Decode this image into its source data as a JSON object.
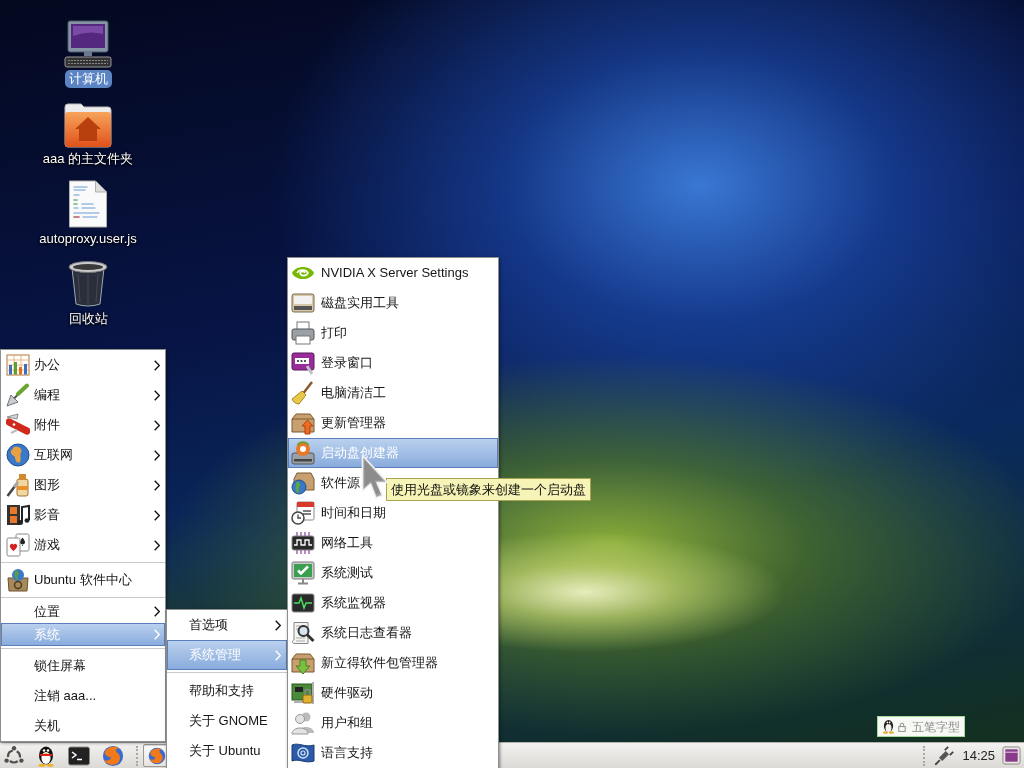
{
  "desktop_icons": [
    {
      "label": "计算机",
      "selected": true
    },
    {
      "label": "aaa 的主文件夹",
      "selected": false
    },
    {
      "label": "autoproxy.user.js",
      "selected": false
    },
    {
      "label": "回收站",
      "selected": false
    }
  ],
  "main_menu": {
    "sections": [
      [
        {
          "label": "办公",
          "submenu": true,
          "selected": false
        },
        {
          "label": "编程",
          "submenu": true,
          "selected": false
        },
        {
          "label": "附件",
          "submenu": true,
          "selected": false
        },
        {
          "label": "互联网",
          "submenu": true,
          "selected": false
        },
        {
          "label": "图形",
          "submenu": true,
          "selected": false
        },
        {
          "label": "影音",
          "submenu": true,
          "selected": false
        },
        {
          "label": "游戏",
          "submenu": true,
          "selected": false
        }
      ],
      [
        {
          "label": "Ubuntu 软件中心",
          "submenu": false,
          "selected": false
        }
      ],
      [
        {
          "label": "位置",
          "submenu": true,
          "selected": false
        },
        {
          "label": "系统",
          "submenu": true,
          "selected": true
        }
      ],
      [
        {
          "label": "锁住屏幕",
          "submenu": false,
          "selected": false
        },
        {
          "label": "注销 aaa...",
          "submenu": false,
          "selected": false
        },
        {
          "label": "关机",
          "submenu": false,
          "selected": false
        }
      ]
    ]
  },
  "system_submenu": {
    "sections": [
      [
        {
          "label": "首选项",
          "submenu": true,
          "selected": false
        },
        {
          "label": "系统管理",
          "submenu": true,
          "selected": true
        }
      ],
      [
        {
          "label": "帮助和支持",
          "submenu": false,
          "selected": false
        },
        {
          "label": "关于 GNOME",
          "submenu": false,
          "selected": false
        },
        {
          "label": "关于 Ubuntu",
          "submenu": false,
          "selected": false
        }
      ]
    ]
  },
  "administration_submenu": {
    "items": [
      {
        "label": "NVIDIA X Server Settings",
        "selected": false
      },
      {
        "label": "磁盘实用工具",
        "selected": false
      },
      {
        "label": "打印",
        "selected": false
      },
      {
        "label": "登录窗口",
        "selected": false
      },
      {
        "label": "电脑清洁工",
        "selected": false
      },
      {
        "label": "更新管理器",
        "selected": false
      },
      {
        "label": "启动盘创建器",
        "selected": true
      },
      {
        "label": "软件源",
        "selected": false
      },
      {
        "label": "时间和日期",
        "selected": false
      },
      {
        "label": "网络工具",
        "selected": false
      },
      {
        "label": "系统测试",
        "selected": false
      },
      {
        "label": "系统监视器",
        "selected": false
      },
      {
        "label": "系统日志查看器",
        "selected": false
      },
      {
        "label": "新立得软件包管理器",
        "selected": false
      },
      {
        "label": "硬件驱动",
        "selected": false
      },
      {
        "label": "用户和组",
        "selected": false
      },
      {
        "label": "语言支持",
        "selected": false
      }
    ]
  },
  "tooltip": {
    "text": "使用光盘或镜象来创建一个启动盘"
  },
  "input_method": {
    "label": "五笔字型"
  },
  "taskbar": {
    "windows": [
      {
        "active": true
      }
    ],
    "clock": "14:25"
  }
}
